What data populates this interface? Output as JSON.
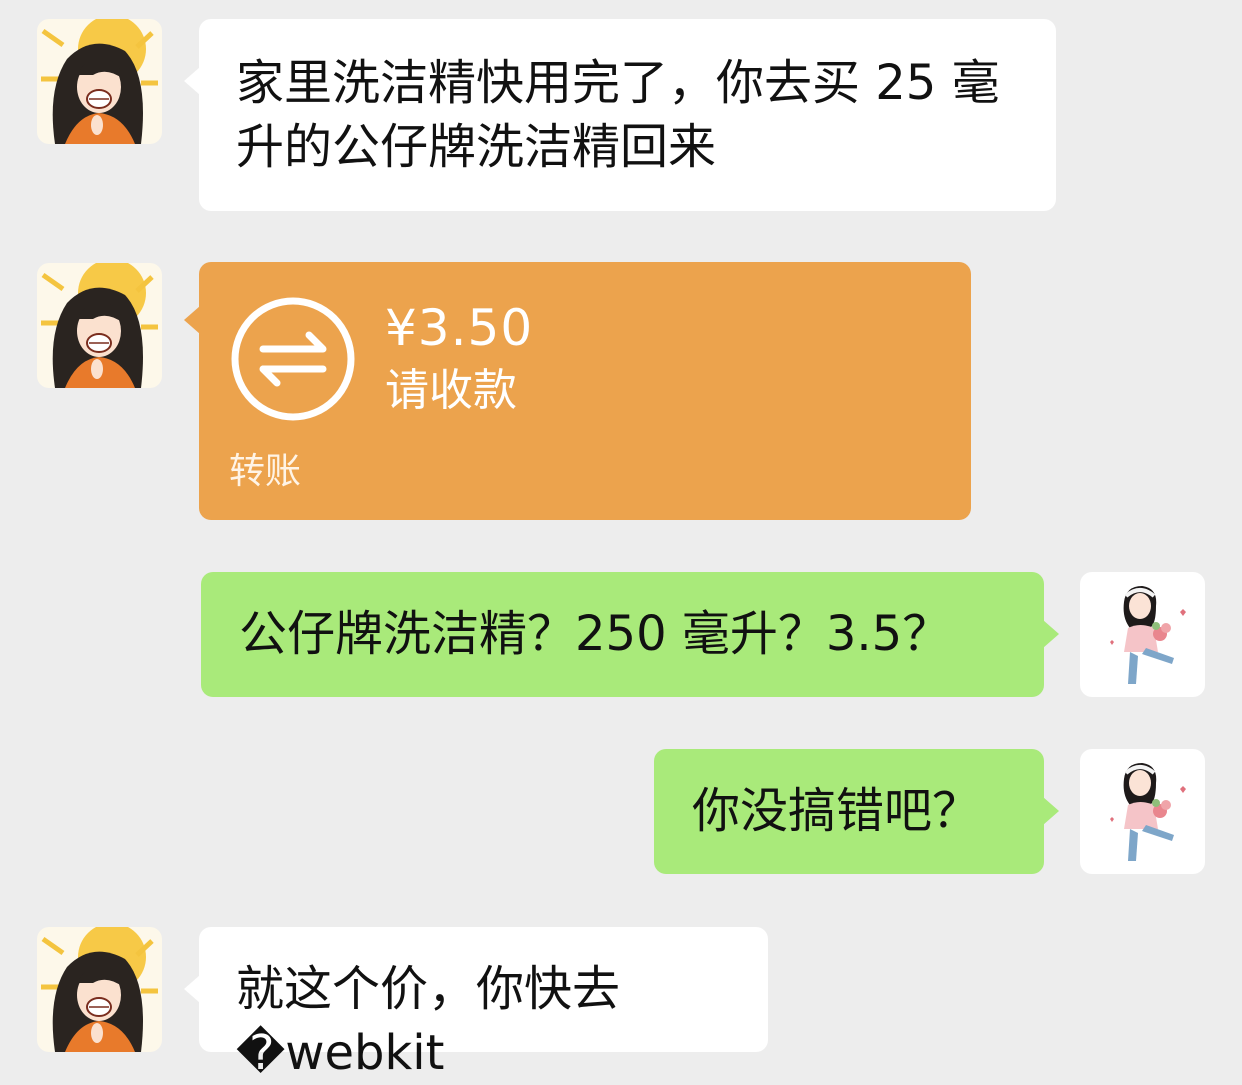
{
  "messages": {
    "m1": {
      "text": "家里洗洁精快用完了，你去买 25 毫升的公仔牌洗洁精回来"
    },
    "m2": {
      "amount": "¥3.50",
      "status": "请收款",
      "type_label": "转账"
    },
    "m3": {
      "text": "公仔牌洗洁精？250 毫升？3.5？"
    },
    "m4": {
      "text": "你没搞错吧？"
    },
    "m5": {
      "text": "就这个价，你快去�webkit"
    }
  },
  "colors": {
    "background": "#ededed",
    "incoming_bubble": "#ffffff",
    "outgoing_bubble": "#a9ea7a",
    "transfer_bubble": "#eca34d"
  },
  "icons": {
    "transfer": "transfer-arrows-icon",
    "contact_avatar": "cartoon-girl-avatar",
    "self_avatar": "cartoon-girl-flowers-avatar"
  }
}
